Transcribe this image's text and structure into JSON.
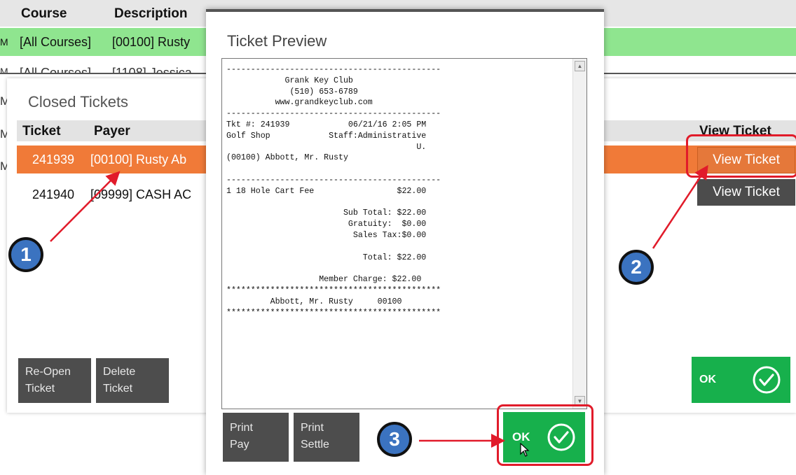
{
  "background_table": {
    "headers": {
      "course": "Course",
      "description": "Description"
    },
    "row1": {
      "course": "[All Courses]",
      "description": "[00100] Rusty"
    },
    "row2": {
      "course": "[All Courses]",
      "description": "[1108] Jessica"
    },
    "row_marker": "M"
  },
  "closed_tickets": {
    "title": "Closed Tickets",
    "columns": {
      "ticket": "Ticket",
      "payer": "Payer",
      "view": "View Ticket"
    },
    "rows": [
      {
        "ticket": "241939",
        "payer": "[00100] Rusty Ab",
        "view_label": "View Ticket",
        "selected": true
      },
      {
        "ticket": "241940",
        "payer": "[09999] CASH AC",
        "view_label": "View Ticket",
        "selected": false
      }
    ],
    "buttons": {
      "reopen": {
        "line1": "Re-Open",
        "line2": "Ticket"
      },
      "delete": {
        "line1": "Delete",
        "line2": "Ticket"
      },
      "ok": "OK"
    }
  },
  "ticket_preview": {
    "title": "Ticket Preview",
    "receipt_lines": [
      "--------------------------------------------",
      "            Grank Key Club",
      "             (510) 653-6789",
      "          www.grandkeyclub.com",
      "--------------------------------------------",
      "Tkt #: 241939            06/21/16 2:05 PM",
      "Golf Shop            Staff:Administrative",
      "                                       U.",
      "(00100) Abbott, Mr. Rusty",
      "",
      "--------------------------------------------",
      "1 18 Hole Cart Fee                 $22.00",
      "",
      "                        Sub Total: $22.00",
      "                         Gratuity:  $0.00",
      "                          Sales Tax:$0.00",
      "",
      "                            Total: $22.00",
      "",
      "                   Member Charge: $22.00",
      "********************************************",
      "         Abbott, Mr. Rusty     00100",
      "********************************************"
    ],
    "buttons": {
      "print_pay": {
        "line1": "Print",
        "line2": "Pay"
      },
      "print_settle": {
        "line1": "Print",
        "line2": "Settle"
      },
      "ok": "OK"
    }
  },
  "callouts": [
    "1",
    "2",
    "3"
  ],
  "colors": {
    "selected_row": "#f07a38",
    "green_row": "#8fe58f",
    "ok_green": "#17b04c",
    "dark_button": "#4d4d4d",
    "callout_blue": "#3b73c0",
    "annotation_red": "#e11b2a"
  },
  "icons": {
    "ok": "checkmark-circle-icon",
    "cursor": "mouse-pointer-icon",
    "scroll_up": "scroll-up-arrow-icon",
    "scroll_down": "scroll-down-arrow-icon"
  }
}
